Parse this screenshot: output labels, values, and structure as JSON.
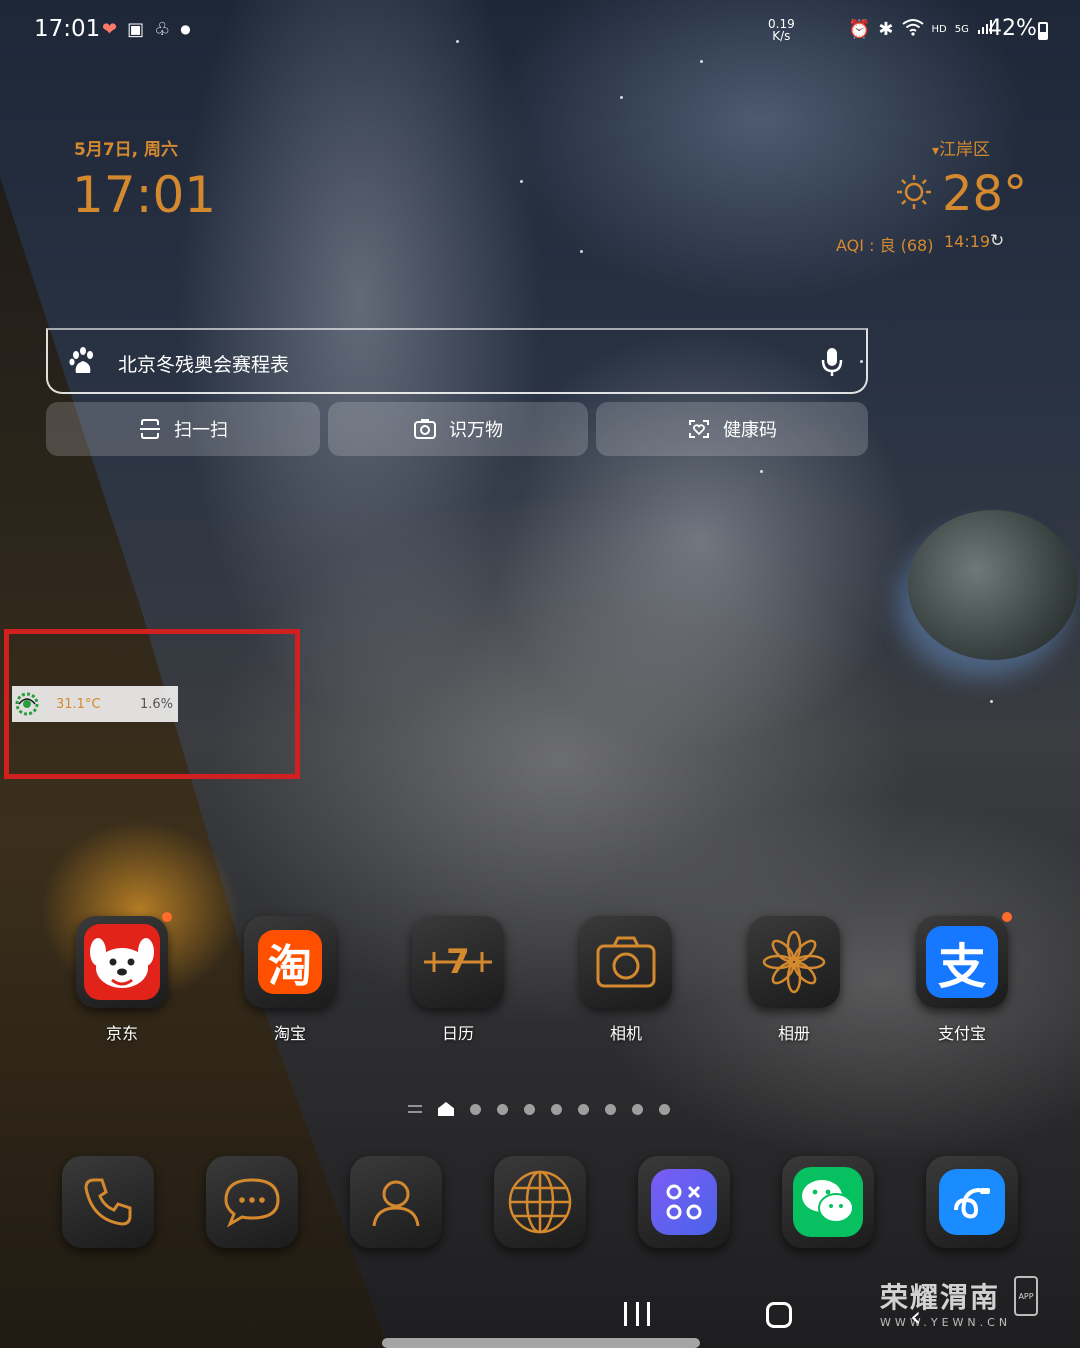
{
  "status_bar": {
    "time": "17:01",
    "left_icons": [
      "heart-icon",
      "gallery-icon",
      "accessibility-icon",
      "dot-icon"
    ],
    "net_speed_value": "0.19",
    "net_speed_unit": "K/s",
    "right_icons": [
      "alarm-icon",
      "bluetooth-icon",
      "wifi-icon",
      "hd-icon",
      "5g-signal-icon"
    ],
    "hd_label": "HD",
    "signal_label": "5G",
    "battery": "42%"
  },
  "clock_widget": {
    "date": "5月7日, 周六",
    "time": "17:01"
  },
  "weather_widget": {
    "location": "江岸区",
    "temperature": "28°",
    "aqi": "AQI : 良 (68)",
    "updated": "14:19"
  },
  "search": {
    "query": "北京冬残奥会赛程表"
  },
  "quick_actions": [
    {
      "label": "扫一扫",
      "icon": "scan-icon"
    },
    {
      "label": "识万物",
      "icon": "camera-lens-icon"
    },
    {
      "label": "健康码",
      "icon": "health-code-icon"
    }
  ],
  "monitor_widget": {
    "temperature": "31.1°C",
    "usage": "1.6%"
  },
  "apps": [
    {
      "label": "京东",
      "icon": "jd-icon",
      "badge": true
    },
    {
      "label": "淘宝",
      "icon": "taobao-icon",
      "badge": false
    },
    {
      "label": "日历",
      "icon": "calendar-icon",
      "badge": false,
      "glyph": "7"
    },
    {
      "label": "相机",
      "icon": "camera-icon",
      "badge": false
    },
    {
      "label": "相册",
      "icon": "gallery-flower-icon",
      "badge": false
    },
    {
      "label": "支付宝",
      "icon": "alipay-icon",
      "badge": true
    }
  ],
  "taobao_glyph": "淘",
  "alipay_glyph": "支",
  "page_indicator": {
    "total_dots": 8,
    "current": "home"
  },
  "dock": [
    {
      "icon": "phone-icon"
    },
    {
      "icon": "messages-icon"
    },
    {
      "icon": "contacts-icon"
    },
    {
      "icon": "browser-globe-icon"
    },
    {
      "icon": "game-launcher-icon"
    },
    {
      "icon": "wechat-icon"
    },
    {
      "icon": "samsung-flow-icon"
    }
  ],
  "watermark": {
    "title": "荣耀渭南",
    "subtitle": "WWW.YEWN.CN",
    "app_label": "APP"
  },
  "colors": {
    "accent": "#d4892f",
    "highlight_box": "#d0201f",
    "jd_red": "#e2231a",
    "taobao_orange": "#ff5000",
    "alipay_blue": "#1677ff",
    "wechat_green": "#07c160"
  }
}
